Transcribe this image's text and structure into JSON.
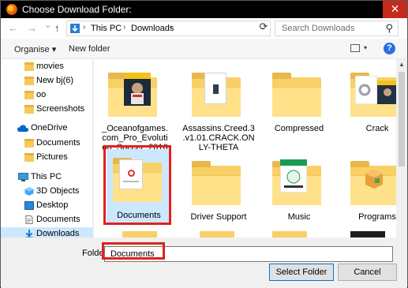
{
  "window": {
    "title": "Choose Download Folder:",
    "close_glyph": "✕"
  },
  "nav": {
    "back_glyph": "←",
    "forward_glyph": "→",
    "dropdown_glyph": "⌄",
    "up_glyph": "↑",
    "breadcrumb": [
      "This PC",
      "Downloads"
    ],
    "breadcrumb_sep": "›",
    "address_dropdown_glyph": "⌄",
    "refresh_glyph": "⟳",
    "search_placeholder": "Search Downloads",
    "search_glyph": "⚲"
  },
  "toolbar": {
    "organise_label": "Organise ▾",
    "new_folder_label": "New folder",
    "view_dropdown_glyph": "▾",
    "help_glyph": "?"
  },
  "sidebar": {
    "items": [
      {
        "label": "movies",
        "icon": "folder-icon"
      },
      {
        "label": "New bj(6)",
        "icon": "folder-icon"
      },
      {
        "label": "oo",
        "icon": "folder-icon"
      },
      {
        "label": "Screenshots",
        "icon": "folder-icon"
      },
      {
        "label": "OneDrive",
        "icon": "cloud-icon"
      },
      {
        "label": "Documents",
        "icon": "folder-icon"
      },
      {
        "label": "Pictures",
        "icon": "folder-icon"
      },
      {
        "label": "This PC",
        "icon": "computer-icon"
      },
      {
        "label": "3D Objects",
        "icon": "cube-icon"
      },
      {
        "label": "Desktop",
        "icon": "desktop-icon"
      },
      {
        "label": "Documents",
        "icon": "document-icon"
      },
      {
        "label": "Downloads",
        "icon": "download-icon"
      }
    ],
    "selected_index": 11
  },
  "files": [
    {
      "label": "_Oceanofgames.\ncom_Pro_Evoluti\non_Soccer_2016",
      "kind": "game-folder"
    },
    {
      "label": "Assassins.Creed.3\n.v1.01.CRACK.ON\nLY-THETA",
      "kind": "doc-folder"
    },
    {
      "label": "Compressed",
      "kind": "folder"
    },
    {
      "label": "Crack",
      "kind": "gear-folder"
    },
    {
      "label": "Documents",
      "kind": "doc-folder",
      "selected": true
    },
    {
      "label": "Driver Support",
      "kind": "folder"
    },
    {
      "label": "Music",
      "kind": "app-folder"
    },
    {
      "label": "Programs",
      "kind": "box-folder"
    }
  ],
  "footer": {
    "folder_label": "Folder:",
    "folder_value": "Documents",
    "select_button": "Select Folder",
    "cancel_button": "Cancel"
  },
  "colors": {
    "highlight": "#e2211c",
    "selection": "#cce8ff",
    "folder": "#f8d067",
    "accent": "#0078d7"
  }
}
